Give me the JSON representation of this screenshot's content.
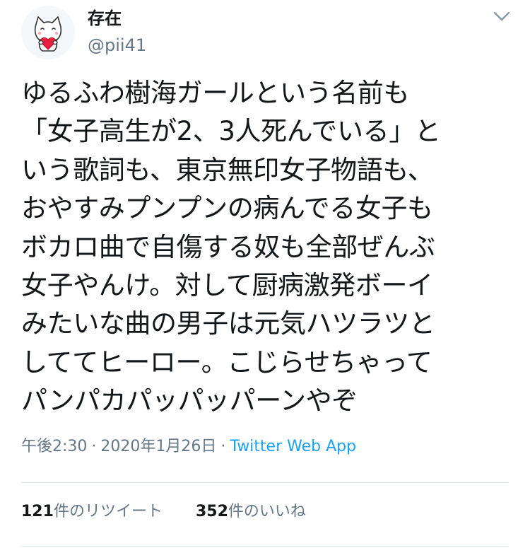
{
  "author": {
    "display_name": "存在",
    "handle": "@pii41"
  },
  "tweet": {
    "lines": [
      "ゆるふわ樹海ガールという名前も",
      "「女子高生が2、3人死んでいる」と",
      "いう歌詞も、東京無印女子物語も、",
      "おやすみプンプンの病んでる女子も",
      "ボカロ曲で自傷する奴も全部ぜんぶ",
      "女子やんけ。対して厨病激発ボーイ",
      "みたいな曲の男子は元気ハツラツと",
      "しててヒーロー。こじらせちゃって",
      "パンパカパッパッパーンやぞ"
    ]
  },
  "meta": {
    "time": "午後2:30",
    "date": "2020年1月26日",
    "separator": "·",
    "source": "Twitter Web App"
  },
  "stats": {
    "retweets_count": "121",
    "retweets_label": "件のリツイート",
    "likes_count": "352",
    "likes_label": "件のいいね"
  },
  "icons": {
    "menu": "chevron-down-icon",
    "avatar": "cat-holding-heart-avatar"
  },
  "colors": {
    "text": "#14171a",
    "secondary": "#657786",
    "link": "#1da1f2",
    "divider": "#e1e8ed",
    "avatar_heart": "#e8203c"
  }
}
